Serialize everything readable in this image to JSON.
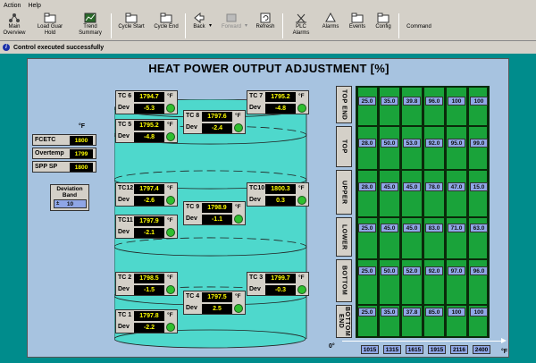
{
  "menu": {
    "action": "Action",
    "help": "Help"
  },
  "toolbar": [
    {
      "label": "Main Overview",
      "icon": "tree-icon"
    },
    {
      "label": "Load Guar Hold",
      "icon": "folder-icon"
    },
    {
      "label": "Trend Summary",
      "icon": "trend-icon"
    },
    {
      "label": "Cycle Start",
      "icon": "folder-icon"
    },
    {
      "label": "Cycle End",
      "icon": "folder-icon"
    },
    {
      "label": "Back",
      "icon": "back-icon"
    },
    {
      "label": "Forward",
      "icon": "forward-icon"
    },
    {
      "label": "Refresh",
      "icon": "refresh-icon"
    },
    {
      "label": "PLC Alarms",
      "icon": "alarm-icon"
    },
    {
      "label": "Alarms",
      "icon": "bell-icon"
    },
    {
      "label": "Events",
      "icon": "folder-icon"
    },
    {
      "label": "Config",
      "icon": "folder-icon"
    },
    {
      "label": "Command",
      "icon": "command-icon"
    }
  ],
  "status": {
    "icon": "info-icon",
    "text": "Control executed successfully"
  },
  "title": "HEAT POWER OUTPUT ADJUSTMENT [%]",
  "setpoints": {
    "unit": "°F",
    "rows": [
      {
        "label": "FCETC",
        "value": "1800"
      },
      {
        "label": "Overtemp",
        "value": "1799"
      },
      {
        "label": "SPP SP",
        "value": "1800"
      }
    ]
  },
  "deviation_band": {
    "label": "Deviation Band",
    "value": "10"
  },
  "thermocouples": [
    {
      "name": "TC 6",
      "temp": "1794.7",
      "dev": "-5.3"
    },
    {
      "name": "TC 8",
      "temp": "1797.6",
      "dev": "-2.4"
    },
    {
      "name": "TC 7",
      "temp": "1795.2",
      "dev": "-4.8"
    },
    {
      "name": "TC 5",
      "temp": "1795.2",
      "dev": "-4.8"
    },
    {
      "name": "TC12",
      "temp": "1797.4",
      "dev": "-2.6"
    },
    {
      "name": "TC 9",
      "temp": "1798.9",
      "dev": "-1.1"
    },
    {
      "name": "TC10",
      "temp": "1800.3",
      "dev": "0.3"
    },
    {
      "name": "TC11",
      "temp": "1797.9",
      "dev": "-2.1"
    },
    {
      "name": "TC 2",
      "temp": "1798.5",
      "dev": "-1.5"
    },
    {
      "name": "TC 4",
      "temp": "1797.5",
      "dev": "2.5"
    },
    {
      "name": "TC 3",
      "temp": "1799.7",
      "dev": "-0.3"
    },
    {
      "name": "TC 1",
      "temp": "1797.8",
      "dev": "-2.2"
    }
  ],
  "tc_labels": {
    "dev": "Dev",
    "unit": "°F"
  },
  "zones": [
    "TOP END",
    "TOP",
    "UPPER",
    "LOWER",
    "BOTTOM",
    "BOTTOM END"
  ],
  "grid": [
    [
      "25.0",
      "35.0",
      "39.8",
      "96.0",
      "100",
      "100"
    ],
    [
      "28.0",
      "50.0",
      "53.0",
      "92.0",
      "95.0",
      "99.0"
    ],
    [
      "28.0",
      "45.0",
      "45.0",
      "78.0",
      "47.0",
      "15.0"
    ],
    [
      "25.0",
      "45.0",
      "45.0",
      "83.0",
      "71.0",
      "63.0"
    ],
    [
      "25.0",
      "50.0",
      "52.0",
      "92.0",
      "97.0",
      "96.0"
    ],
    [
      "25.0",
      "35.0",
      "37.8",
      "85.0",
      "100",
      "100"
    ]
  ],
  "x_axis": {
    "start": "0°",
    "unit": "°F",
    "values": [
      "1015",
      "1315",
      "1615",
      "1915",
      "2116",
      "2400"
    ]
  }
}
